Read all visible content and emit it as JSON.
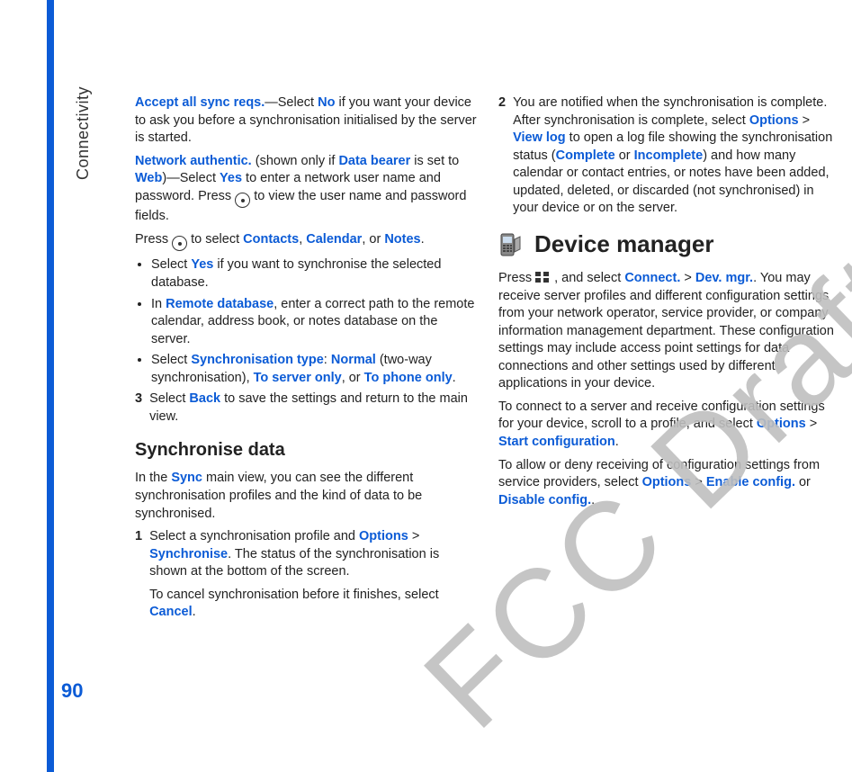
{
  "sidebar": {
    "label": "Connectivity",
    "page_number": "90"
  },
  "watermark": "FCC Draft",
  "left": {
    "p1": {
      "t1": "Accept all sync reqs.",
      "t2": "—Select ",
      "t3": "No",
      "t4": " if you want your device to ask you before a synchronisation initialised by the server is started."
    },
    "p2": {
      "t1": "Network authentic.",
      "t2": " (shown only if ",
      "t3": "Data bearer",
      "t4": " is set to ",
      "t5": "Web",
      "t6": ")—Select ",
      "t7": "Yes",
      "t8": " to enter a network user name and password. Press ",
      "t9": " to view the user name and password fields."
    },
    "p3": {
      "t1": "Press ",
      "t2": " to select ",
      "t3": "Contacts",
      "t4": ", ",
      "t5": "Calendar",
      "t6": ", or ",
      "t7": "Notes",
      "t8": "."
    },
    "b1": {
      "t1": "Select ",
      "t2": "Yes",
      "t3": " if you want to synchronise the selected database."
    },
    "b2": {
      "t1": "In ",
      "t2": "Remote database",
      "t3": ", enter a correct path to the remote calendar, address book, or notes database on the server."
    },
    "b3": {
      "t1": "Select ",
      "t2": "Synchronisation type",
      "t3": ": ",
      "t4": "Normal",
      "t5": " (two-way synchronisation), ",
      "t6": "To server only",
      "t7": ", or ",
      "t8": "To phone only",
      "t9": "."
    },
    "s3": {
      "num": "3",
      "t1": "Select ",
      "t2": "Back",
      "t3": " to save the settings and return to the main view."
    },
    "h3": "Synchronise data",
    "p4": {
      "t1": "In the ",
      "t2": "Sync",
      "t3": " main view, you can see the different synchronisation profiles and the kind of data to be synchronised."
    },
    "s1": {
      "num": "1",
      "t1": "Select a synchronisation profile and ",
      "t2": "Options",
      "t3": " > ",
      "t4": "Synchronise",
      "t5": ". The status of the synchronisation is shown at the bottom of the screen.",
      "t6": "To cancel synchronisation before it finishes, select ",
      "t7": "Cancel",
      "t8": "."
    }
  },
  "right": {
    "s2": {
      "num": "2",
      "t1": "You are notified when the synchronisation is complete. After synchronisation is complete, select ",
      "t2": "Options",
      "t3": " > ",
      "t4": "View log",
      "t5": " to open a log file showing the synchronisation status (",
      "t6": "Complete",
      "t7": " or ",
      "t8": "Incomplete",
      "t9": ") and how many calendar or contact entries, or notes have been added, updated, deleted, or discarded (not synchronised) in your device or on the server."
    },
    "h2": "Device manager",
    "p5": {
      "t1": "Press ",
      "t2": " , and select ",
      "t3": "Connect.",
      "t4": " > ",
      "t5": "Dev. mgr.",
      "t6": ". You may receive server profiles and different configuration settings from your network operator, service provider, or company information management department. These configuration settings may include access point settings for data connections and other settings used by different applications in your device."
    },
    "p6": {
      "t1": "To connect to a server and receive configuration settings for your device, scroll to a profile, and select ",
      "t2": "Options",
      "t3": " > ",
      "t4": "Start configuration",
      "t5": "."
    },
    "p7": {
      "t1": "To allow or deny receiving of configuration settings from service providers, select ",
      "t2": "Options",
      "t3": " > ",
      "t4": "Enable config.",
      "t5": " or ",
      "t6": "Disable config.",
      "t7": "."
    }
  }
}
